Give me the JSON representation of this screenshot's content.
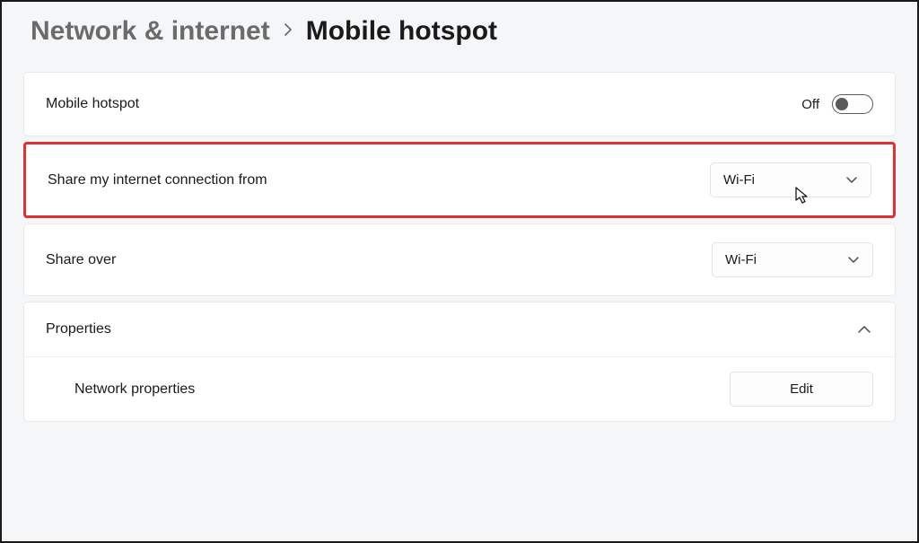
{
  "breadcrumb": {
    "parent": "Network & internet",
    "current": "Mobile hotspot"
  },
  "rows": {
    "hotspot": {
      "label": "Mobile hotspot",
      "toggle_state": "Off"
    },
    "share_from": {
      "label": "Share my internet connection from",
      "value": "Wi-Fi"
    },
    "share_over": {
      "label": "Share over",
      "value": "Wi-Fi"
    },
    "properties": {
      "label": "Properties",
      "subitem": "Network properties",
      "edit_label": "Edit"
    }
  }
}
